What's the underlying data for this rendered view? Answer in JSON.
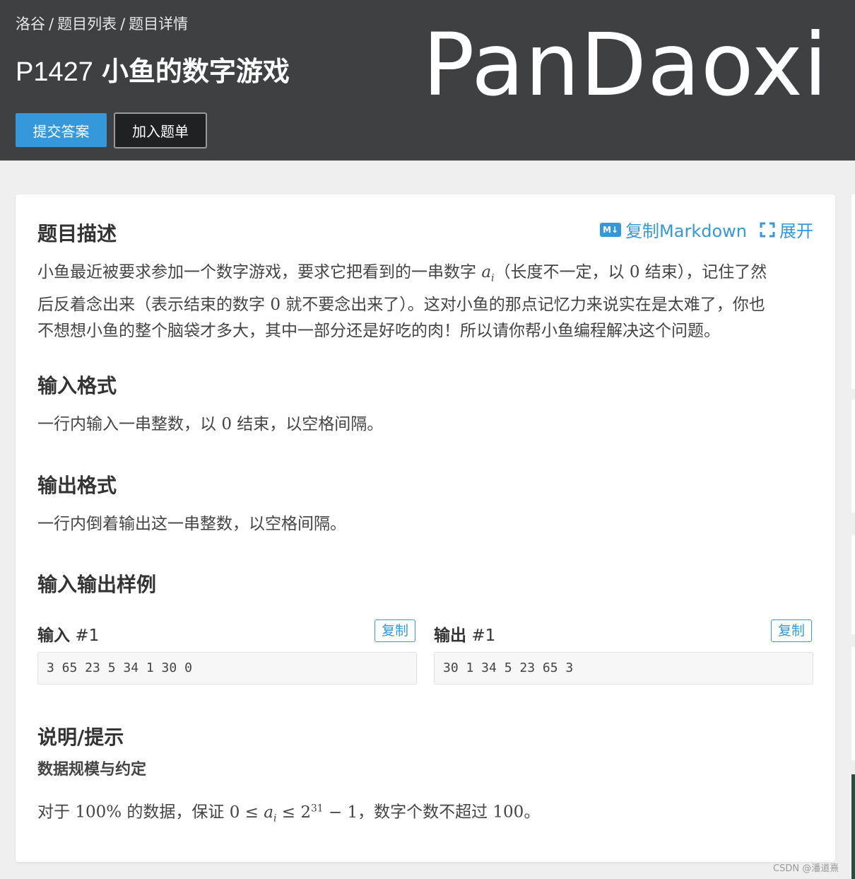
{
  "breadcrumb": {
    "items": [
      "洛谷",
      "题目列表",
      "题目详情"
    ],
    "separator": "/"
  },
  "problem": {
    "id": "P1427",
    "name": "小鱼的数字游戏"
  },
  "actions": {
    "submit": "提交答案",
    "add_to_list": "加入题单"
  },
  "watermark": "PanDaoxi",
  "toolbar": {
    "copy_markdown": "复制Markdown",
    "expand": "展开",
    "md_icon": "M↓"
  },
  "description": {
    "heading": "题目描述",
    "line1_a": "小鱼最近被要求参加一个数字游戏，要求它把看到的一串数字 ",
    "var_a": "a",
    "var_i": "i",
    "line1_b": "（长度不一定，以 ",
    "zero": "0",
    "line1_c": " 结束），记住了然",
    "line2_a": "后反着念出来（表示结束的数字 ",
    "line2_b": " 就不要念出来了）。这对小鱼的那点记忆力来说实在是太难了，你也",
    "line3": "不想想小鱼的整个脑袋才多大，其中一部分还是好吃的肉！所以请你帮小鱼编程解决这个问题。"
  },
  "input_format": {
    "heading": "输入格式",
    "text_a": "一行内输入一串整数，以 ",
    "text_b": " 结束，以空格间隔。"
  },
  "output_format": {
    "heading": "输出格式",
    "text": "一行内倒着输出这一串整数，以空格间隔。"
  },
  "samples": {
    "heading": "输入输出样例",
    "input_label": "输入",
    "output_label": "输出",
    "index": "#1",
    "copy": "复制",
    "input": "3 65 23 5 34 1 30 0",
    "output": "30 1 34 5 23 65 3"
  },
  "hint": {
    "heading": "说明/提示",
    "subheading": "数据规模与约定",
    "text_a": "对于 ",
    "percent": "100%",
    "text_b": " 的数据，保证 ",
    "le": "≤",
    "pow_base": "2",
    "pow_exp": "31",
    "minus_one": " − 1",
    "text_c": "，数字个数不超过 ",
    "max": "100",
    "text_d": "。"
  },
  "footer": {
    "credit": "CSDN @潘道熹"
  },
  "colors": {
    "header_bg": "#3f4042",
    "accent": "#3498db",
    "page_bg": "#efefef"
  }
}
